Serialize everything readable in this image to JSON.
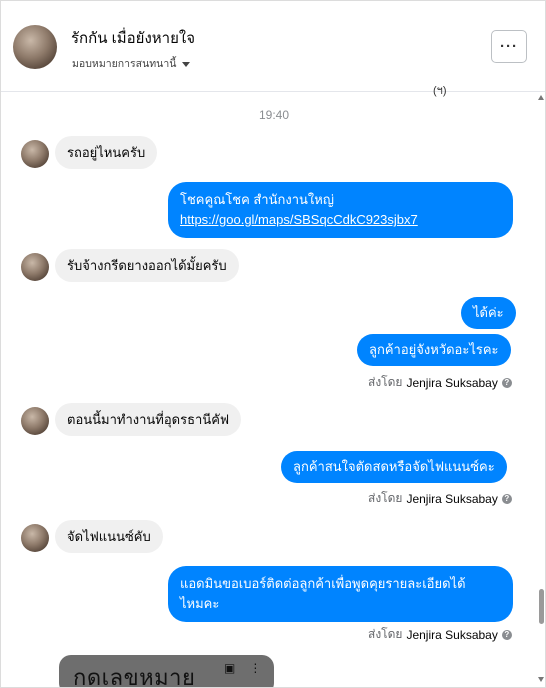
{
  "header": {
    "name": "รักกัน เมื่อยังหายใจ",
    "assign_label": "มอบหมายการสนทนานี้",
    "more_label": "···"
  },
  "clipped_marker": "(ฯ)",
  "time_divider": "19:40",
  "messages": [
    {
      "dir": "in",
      "text": "รถอยู่ไหนครับ"
    },
    {
      "dir": "out",
      "line1": "โชคคูณโชค สำนักงานใหญ่",
      "link": "https://goo.gl/maps/SBSqcCdkC923sjbx7"
    },
    {
      "dir": "in",
      "text": "รับจ้างกรีดยางออกได้มั้ยครับ"
    },
    {
      "dir": "out",
      "text": "ได้ค่ะ"
    },
    {
      "dir": "out",
      "text": "ลูกค้าอยู่จังหวัดอะไรคะ"
    },
    {
      "dir": "in",
      "text": "ตอนนี้มาทำงานที่อุดรธานีคัฟ"
    },
    {
      "dir": "out",
      "text": "ลูกค้าสนใจตัดสดหรือจัดไฟแนนซ์คะ"
    },
    {
      "dir": "in",
      "text": "จัดไฟแนนซ์คับ"
    },
    {
      "dir": "out",
      "line1": "แอดมินขอเบอร์ติดต่อลูกค้าเพื่อพูดคุยรายละเอียดได้",
      "line2": "ไหมคะ"
    }
  ],
  "sent_by": {
    "prefix": "ส่งโดย",
    "name": "Jenjira Suksabay",
    "help_icon": "question-circle-icon"
  },
  "image_preview": {
    "text": "กดเลขหมาย",
    "icons": [
      "save-icon",
      "more-vertical-icon"
    ]
  },
  "colors": {
    "outgoing": "#0084ff",
    "incoming": "#f0f0f0"
  }
}
